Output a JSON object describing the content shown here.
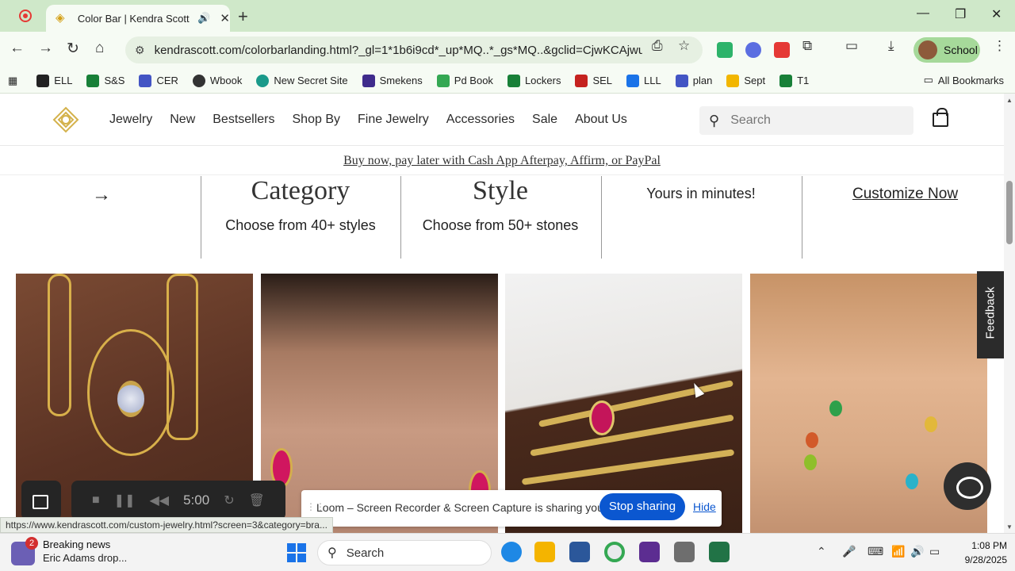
{
  "browser": {
    "tab_title": "Color Bar | Kendra Scott",
    "url": "kendrascott.com/colorbarlanding.html?_gl=1*1b6i9cd*_up*MQ..*_gs*MQ..&gclid=CjwKCAjwuePG...",
    "profile_label": "School",
    "bookmarks": [
      {
        "label": "ELL",
        "color": "#222222"
      },
      {
        "label": "S&S",
        "color": "#188038"
      },
      {
        "label": "CER",
        "color": "#4355c4"
      },
      {
        "label": "Wbook",
        "color": "#333333"
      },
      {
        "label": "New Secret Site",
        "color": "#1a9a8a"
      },
      {
        "label": "Smekens",
        "color": "#3f2b8c"
      },
      {
        "label": "Pd Book",
        "color": "#34a853"
      },
      {
        "label": "Lockers",
        "color": "#188038"
      },
      {
        "label": "SEL",
        "color": "#c5221f"
      },
      {
        "label": "LLL",
        "color": "#1a73e8"
      },
      {
        "label": "plan",
        "color": "#4355c4"
      },
      {
        "label": "Sept",
        "color": "#f2b600"
      },
      {
        "label": "T1",
        "color": "#188038"
      }
    ],
    "all_bookmarks_label": "All Bookmarks",
    "status_url": "https://www.kendrascott.com/custom-jewelry.html?screen=3&category=bra..."
  },
  "site": {
    "nav": [
      "Jewelry",
      "New",
      "Bestsellers",
      "Shop By",
      "Fine Jewelry",
      "Accessories",
      "Sale",
      "About Us"
    ],
    "search_placeholder": "Search",
    "promo": "Buy now, pay later with Cash App Afterpay, Affirm, or PayPal",
    "arrow": "→",
    "steps": [
      {
        "title": "Category",
        "subtitle": "Choose from 40+ styles"
      },
      {
        "title": "Style",
        "subtitle": "Choose from 50+ stones"
      },
      {
        "text": "Yours in minutes!"
      }
    ],
    "customize_link": "Customize Now",
    "feedback_label": "Feedback",
    "brand_color": "#d4b24c"
  },
  "loom": {
    "timer": "5:00",
    "share_message": "Loom – Screen Recorder & Screen Capture is sharing your screen.",
    "stop_label": "Stop sharing",
    "hide_label": "Hide"
  },
  "taskbar": {
    "news_badge": "2",
    "news_title": "Breaking news",
    "news_subtitle": "Eric Adams drop...",
    "search_label": "Search",
    "time": "1:08 PM",
    "date": "9/28/2025"
  }
}
